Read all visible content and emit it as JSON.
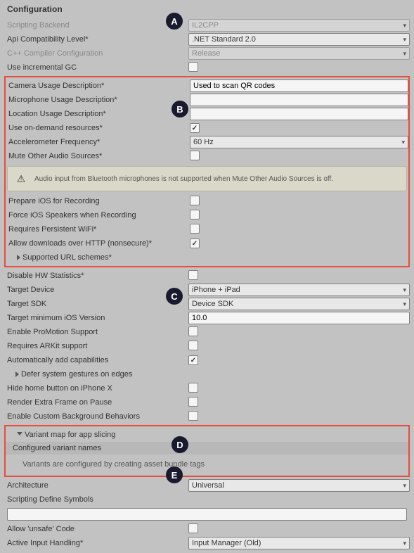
{
  "header": "Configuration",
  "markers": {
    "A": "A",
    "B": "B",
    "C": "C",
    "D": "D",
    "E": "E"
  },
  "top": {
    "scripting_backend": {
      "label": "Scripting Backend",
      "value": "IL2CPP"
    },
    "api_compat": {
      "label": "Api Compatibility Level*",
      "value": ".NET Standard 2.0"
    },
    "cpp_compiler": {
      "label": "C++ Compiler Configuration",
      "value": "Release"
    },
    "incremental_gc": {
      "label": "Use incremental GC"
    }
  },
  "box_b": {
    "camera": {
      "label": "Camera Usage Description*",
      "value": "Used to scan QR codes"
    },
    "microphone": {
      "label": "Microphone Usage Description*",
      "value": ""
    },
    "location": {
      "label": "Location Usage Description*",
      "value": ""
    },
    "ondemand": {
      "label": "Use on-demand resources*"
    },
    "accel": {
      "label": "Accelerometer Frequency*",
      "value": "60 Hz"
    },
    "mute": {
      "label": "Mute Other Audio Sources*"
    },
    "alert": "Audio input from Bluetooth microphones is not supported when Mute Other Audio Sources is off.",
    "prepare": {
      "label": "Prepare iOS for Recording"
    },
    "force_speakers": {
      "label": "Force iOS Speakers when Recording"
    },
    "wifi": {
      "label": "Requires Persistent WiFi*"
    },
    "http": {
      "label": "Allow downloads over HTTP (nonsecure)*"
    },
    "url_schemes": {
      "label": "Supported URL schemes*"
    }
  },
  "mid": {
    "disable_hw": {
      "label": "Disable HW Statistics*"
    },
    "target_device": {
      "label": "Target Device",
      "value": "iPhone + iPad"
    },
    "target_sdk": {
      "label": "Target SDK",
      "value": "Device SDK"
    },
    "min_ios": {
      "label": "Target minimum iOS Version",
      "value": "10.0"
    },
    "promotion": {
      "label": "Enable ProMotion Support"
    },
    "arkit": {
      "label": "Requires ARKit support"
    },
    "auto_caps": {
      "label": "Automatically add capabilities"
    },
    "defer": {
      "label": "Defer system gestures on edges"
    },
    "hide_home": {
      "label": "Hide home button on iPhone X"
    },
    "extra_frame": {
      "label": "Render Extra Frame on Pause"
    },
    "custom_bg": {
      "label": "Enable Custom Background Behaviors"
    }
  },
  "box_d": {
    "title": "Variant map for app slicing",
    "sub": "Configured variant names",
    "info": "Variants are configured by creating asset bundle tags"
  },
  "bottom": {
    "arch": {
      "label": "Architecture",
      "value": "Universal"
    },
    "define": {
      "label": "Scripting Define Symbols"
    },
    "unsafe": {
      "label": "Allow 'unsafe' Code"
    },
    "input": {
      "label": "Active Input Handling*",
      "value": "Input Manager (Old)"
    }
  }
}
